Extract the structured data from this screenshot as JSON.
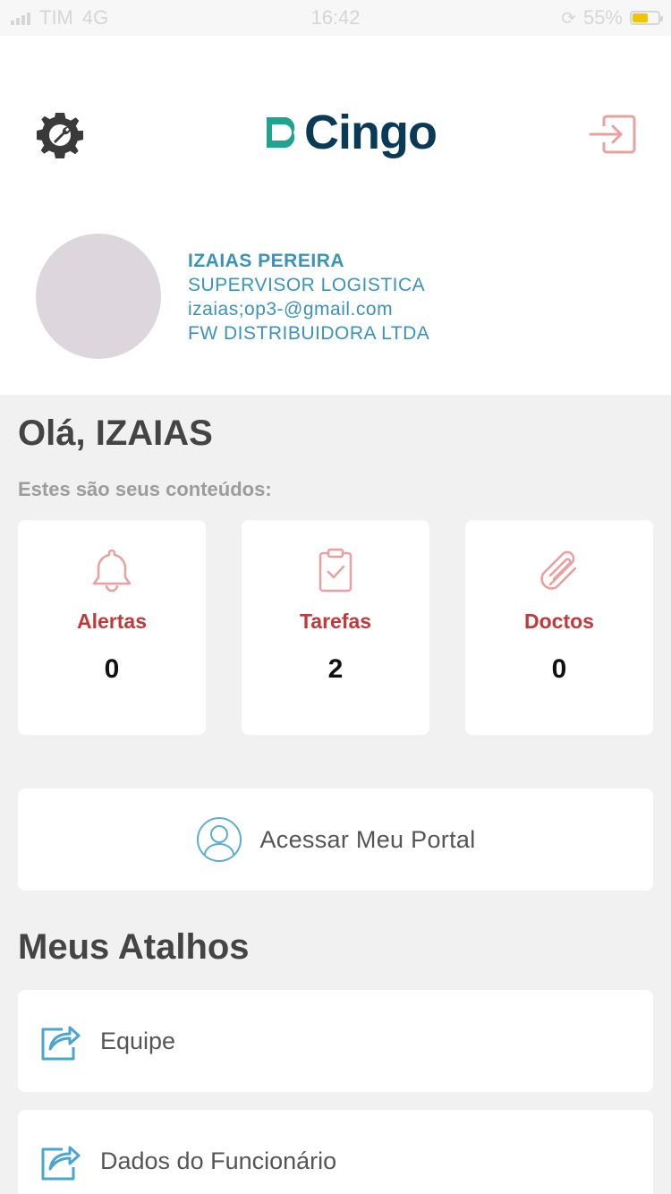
{
  "status_bar": {
    "carrier": "TIM",
    "network": "4G",
    "time": "16:42",
    "battery": "55%"
  },
  "header": {
    "logo_text": "Cingo",
    "icons": {
      "settings": "settings-gear-icon",
      "logout": "logout-icon"
    }
  },
  "profile": {
    "name": "IZAIAS PEREIRA",
    "role": "SUPERVISOR LOGISTICA",
    "email": "izaias;op3-@gmail.com",
    "company": "FW DISTRIBUIDORA LTDA"
  },
  "main": {
    "greeting": "Olá, IZAIAS",
    "subtitle": "Estes são seus conteúdos:",
    "cards": [
      {
        "label": "Alertas",
        "count": "0",
        "icon": "bell-icon"
      },
      {
        "label": "Tarefas",
        "count": "2",
        "icon": "clipboard-check-icon"
      },
      {
        "label": "Doctos",
        "count": "0",
        "icon": "paperclip-icon"
      }
    ],
    "portal_label": "Acessar Meu Portal",
    "shortcuts_title": "Meus Atalhos",
    "shortcuts": [
      {
        "label": "Equipe",
        "icon": "share-icon"
      },
      {
        "label": "Dados do Funcionário",
        "icon": "share-icon"
      }
    ]
  },
  "colors": {
    "accent_blue": "#3b93b8",
    "accent_red": "#c0393b",
    "icon_pink": "#e8a0a0",
    "logo_teal": "#1fa58f",
    "logo_navy": "#0b3a57"
  }
}
